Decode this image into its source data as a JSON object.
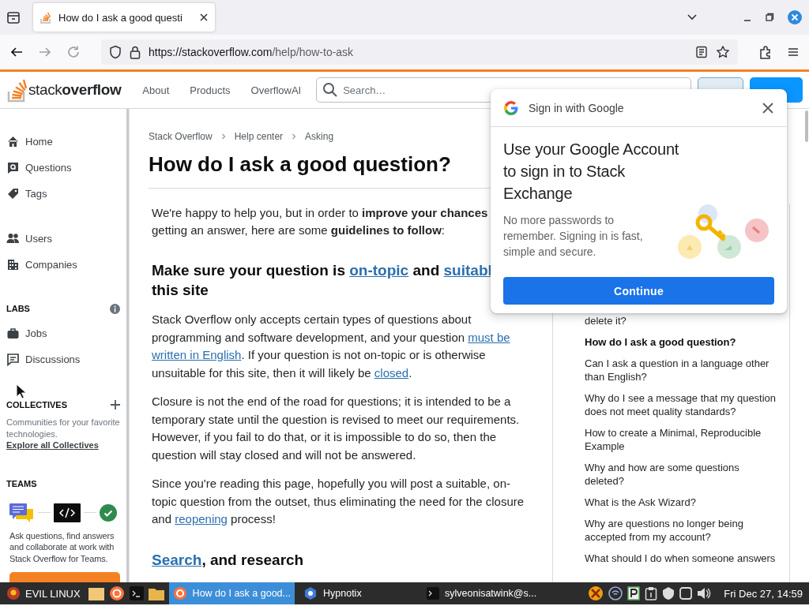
{
  "browser": {
    "tabs": [
      {
        "title": "How do I ask a good questi",
        "selected": true
      }
    ],
    "url_field": {
      "host": "https://stackoverflow.com",
      "path": "/help/how-to-ask"
    }
  },
  "site_header": {
    "logo": "stack**overflow**",
    "nav": [
      "About",
      "Products",
      "OverflowAI"
    ],
    "search": {
      "placeholder": "Search…"
    }
  },
  "left_nav": {
    "groups": [
      [
        {
          "label": "Home",
          "selected": false
        },
        {
          "label": "Questions",
          "selected": false
        },
        {
          "label": "Tags",
          "selected": false
        }
      ],
      [
        {
          "label": "Users",
          "selected": false
        },
        {
          "label": "Companies",
          "selected": false
        }
      ]
    ],
    "labs": {
      "title": "LABS",
      "items": [
        {
          "label": "Jobs",
          "selected": false
        },
        {
          "label": "Discussions",
          "selected": false
        }
      ]
    },
    "collectives": {
      "title": "COLLECTIVES",
      "text": "Communities for your favorite technologies.",
      "link": "Explore all Collectives"
    },
    "teams": {
      "title": "TEAMS",
      "text": "Ask questions, find answers and collaborate at work with Stack Overflow for Teams."
    }
  },
  "article": {
    "breadcrumb": [
      "Stack Overflow",
      "Help center",
      "Asking"
    ],
    "title": "How do I ask a good question?",
    "blocks": [
      {
        "kind": "lines",
        "lines": [
          "We're happy to help you, but in order to **improve your chances**",
          "getting an answer, here are some **guidelines to follow**:"
        ]
      },
      {
        "kind": "heading",
        "lines": [
          [
            {
              "text": "Make sure your question is "
            },
            {
              "text": "on-topic",
              "link": true
            },
            {
              "text": " and "
            },
            {
              "text": "suitabl",
              "link": true
            }
          ],
          [
            {
              "text": "this site"
            }
          ]
        ]
      },
      {
        "kind": "paragraph",
        "parts": [
          {
            "text": "Stack Overflow only accepts certain types of questions about programming and software development, and your question "
          },
          {
            "text": "must be",
            "link": true
          },
          {
            "text": "written in English",
            "link": true
          },
          {
            "text": ". If your question is not on-topic or is otherwise unsuitable for this site, then it will likely be "
          },
          {
            "text": "closed",
            "link": true
          },
          {
            "text": "."
          }
        ]
      },
      {
        "kind": "paragraph",
        "parts": [
          {
            "text": "Closure is not the end of the road for questions; it is intended to be a temporary state until the question is revised to meet our requirements. However, if you fail to do that, or it is impossible to do so, then the question will stay closed and will not be answered."
          }
        ]
      },
      {
        "kind": "paragraph",
        "parts": [
          {
            "text": "Since you're reading this page, hopefully you will post a suitable, on-topic question from the outset, thus eliminating the need for the closure and "
          },
          {
            "text": "reopening",
            "link": true
          },
          {
            "text": " process!"
          }
        ]
      },
      {
        "kind": "heading",
        "lines": [
          [
            {
              "text": "Search",
              "link": true
            },
            {
              "text": ", and research"
            }
          ]
        ]
      }
    ]
  },
  "help_list": {
    "items": [
      {
        "text": "delete it?",
        "selected": false
      },
      {
        "text": "How do I ask a good question?",
        "selected": true
      },
      {
        "text": "Can I ask a question in a language other than English?",
        "selected": false
      },
      {
        "text": "Why do I see a message that my question does not meet quality standards?",
        "selected": false
      },
      {
        "text": "How to create a Minimal, Reproducible Example",
        "selected": false
      },
      {
        "text": "Why and how are some questions deleted?",
        "selected": false
      },
      {
        "text": "What is the Ask Wizard?",
        "selected": false
      },
      {
        "text": "Why are questions no longer being accepted from my account?",
        "selected": false
      },
      {
        "text": "What should I do when someone answers",
        "selected": false
      }
    ]
  },
  "google_popup": {
    "header": "Sign in with Google",
    "title": "Use your Google Account to sign in to Stack Exchange",
    "text": "No more passwords to remember. Signing in is fast, simple and secure.",
    "button": "Continue"
  },
  "taskbar": {
    "start": "EVIL LINUX",
    "tasks": [
      {
        "title": "How do I ask a good...",
        "selected": true
      },
      {
        "title": "Hypnotix",
        "selected": false
      },
      {
        "title": "sylveonisatwink@s...",
        "selected": false
      }
    ],
    "clock": "Fri Dec 27, 14:59"
  }
}
